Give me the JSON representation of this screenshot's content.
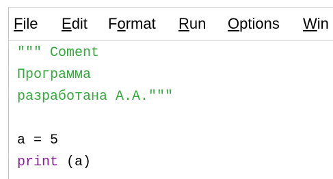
{
  "menubar": {
    "items": [
      {
        "label": "File",
        "mnemonic": "F",
        "rest": "ile"
      },
      {
        "label": "Edit",
        "mnemonic": "E",
        "rest": "dit"
      },
      {
        "label": "Format",
        "pre": "F",
        "mnemonic": "o",
        "rest": "rmat"
      },
      {
        "label": "Run",
        "mnemonic": "R",
        "rest": "un"
      },
      {
        "label": "Options",
        "mnemonic": "O",
        "rest": "ptions"
      },
      {
        "label": "Win",
        "mnemonic": "W",
        "rest": "in"
      }
    ]
  },
  "editor": {
    "lines": [
      {
        "text": "\"\"\" Coment",
        "kind": "string"
      },
      {
        "text": "Программа",
        "kind": "string"
      },
      {
        "text": "разработана А.А.\"\"\"",
        "kind": "string"
      },
      {
        "text": "",
        "kind": "blank"
      },
      {
        "text": "a = 5",
        "kind": "plain"
      },
      {
        "keyword": "print",
        "rest": " (a)",
        "kind": "call"
      }
    ]
  },
  "colors": {
    "string": "#33a83b",
    "keyword": "#8a1f99",
    "plain": "#000000"
  }
}
